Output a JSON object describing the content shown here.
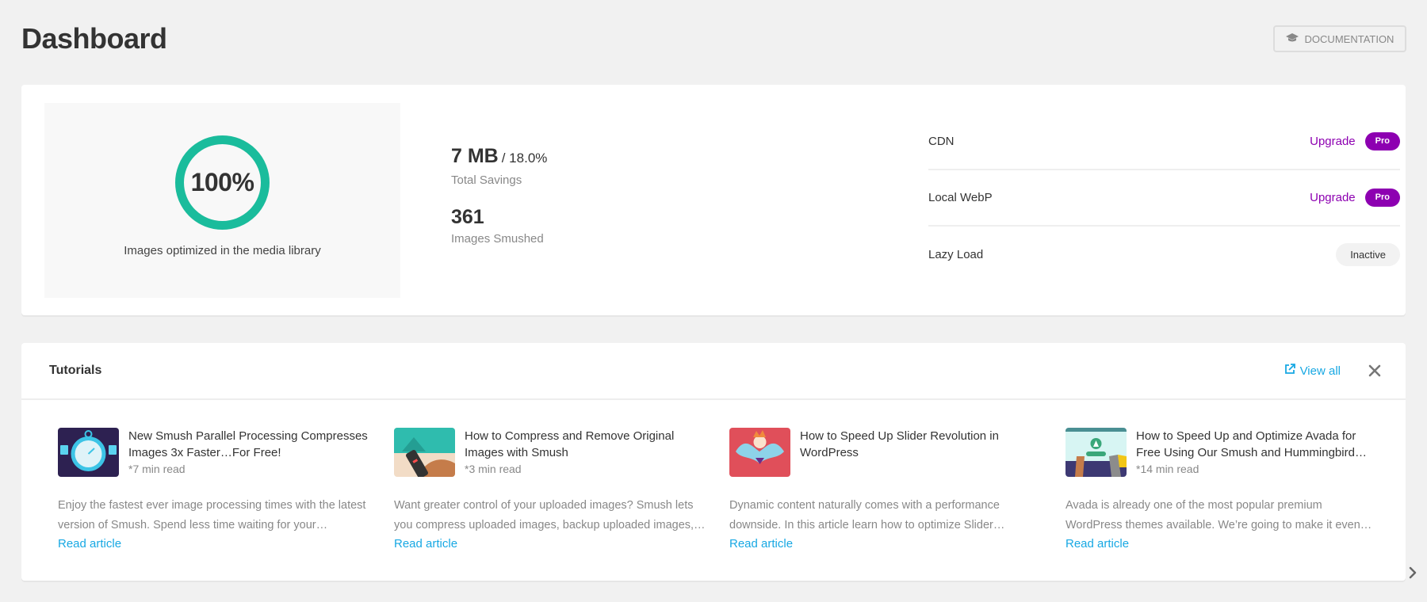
{
  "header": {
    "title": "Dashboard",
    "documentation_label": "DOCUMENTATION",
    "documentation_icon": "graduation-cap-icon"
  },
  "summary": {
    "score_percent": 100,
    "score_label": "100%",
    "score_caption": "Images optimized in the media library",
    "savings_value": "7 MB",
    "savings_percent": "/ 18.0%",
    "savings_label": "Total Savings",
    "smushed_count": "361",
    "smushed_label": "Images Smushed",
    "features": [
      {
        "name": "CDN",
        "action": "Upgrade",
        "badge": "Pro"
      },
      {
        "name": "Local WebP",
        "action": "Upgrade",
        "badge": "Pro"
      },
      {
        "name": "Lazy Load",
        "status": "Inactive"
      }
    ]
  },
  "tutorials": {
    "title": "Tutorials",
    "view_all": "View all",
    "items": [
      {
        "title": "New Smush Parallel Processing Compresses Images 3x Faster…For Free!",
        "read_time": "*7 min read",
        "description": "Enjoy the fastest ever image processing times with the latest version of Smush. Spend less time waiting for your…",
        "link": "Read article"
      },
      {
        "title": "How to Compress and Remove Original Images with Smush",
        "read_time": "*3 min read",
        "description": "Want greater control of your uploaded images? Smush lets you compress uploaded images, backup uploaded images,…",
        "link": "Read article"
      },
      {
        "title": "How to Speed Up Slider Revolution in WordPress",
        "read_time": "",
        "description": "Dynamic content naturally comes with a performance downside. In this article learn how to optimize Slider…",
        "link": "Read article"
      },
      {
        "title": "How to Speed Up and Optimize Avada for Free Using Our Smush and Hummingbird…",
        "read_time": "*14 min read",
        "description": "Avada is already one of the most popular premium WordPress themes available. We’re going to make it even…",
        "link": "Read article"
      }
    ]
  },
  "colors": {
    "accent_green": "#1abc9c",
    "pro_purple": "#8d00b1",
    "link_blue": "#17a8e3"
  }
}
